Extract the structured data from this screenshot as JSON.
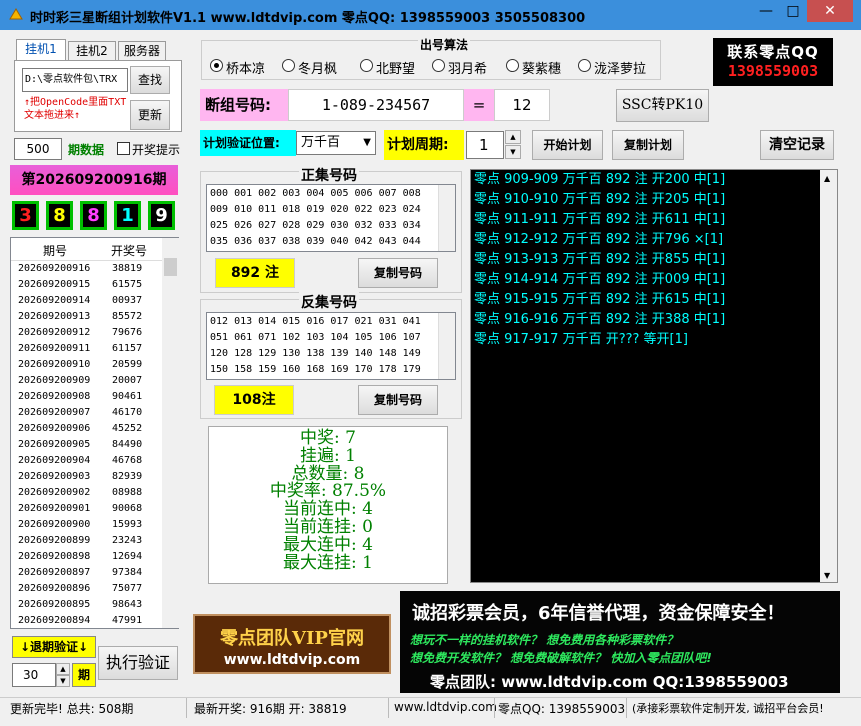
{
  "window": {
    "title": "时时彩三星断组计划软件V1.1   www.ldtdvip.com   零点QQ: 1398559003  3505508300",
    "min_label": "—",
    "max_label": "□",
    "close_label": "✕"
  },
  "tabs": [
    "挂机1",
    "挂机2",
    "服务器"
  ],
  "left": {
    "path_value": "D:\\零点软件包\\TRX",
    "search_btn": "查找",
    "update_btn": "更新",
    "hint": "↑把OpenCode里面TXT文本拖进来↑",
    "period_count": "500",
    "period_label": "期数据",
    "lottery_label": "开奖提示",
    "issue_title": "第202609200916期",
    "balls": [
      {
        "n": "3",
        "color": "#ff2020"
      },
      {
        "n": "8",
        "color": "#ffff00"
      },
      {
        "n": "8",
        "color": "#ff40ff"
      },
      {
        "n": "1",
        "color": "#00ffff"
      },
      {
        "n": "9",
        "color": "#ffffff"
      }
    ],
    "history_headers": [
      "期号",
      "开奖号"
    ],
    "history": [
      [
        "202609200916",
        "38819"
      ],
      [
        "202609200915",
        "61575"
      ],
      [
        "202609200914",
        "00937"
      ],
      [
        "202609200913",
        "85572"
      ],
      [
        "202609200912",
        "79676"
      ],
      [
        "202609200911",
        "61157"
      ],
      [
        "202609200910",
        "20599"
      ],
      [
        "202609200909",
        "20007"
      ],
      [
        "202609200908",
        "90461"
      ],
      [
        "202609200907",
        "46170"
      ],
      [
        "202609200906",
        "45252"
      ],
      [
        "202609200905",
        "84490"
      ],
      [
        "202609200904",
        "46768"
      ],
      [
        "202609200903",
        "82939"
      ],
      [
        "202609200902",
        "08988"
      ],
      [
        "202609200901",
        "90068"
      ],
      [
        "202609200900",
        "15993"
      ],
      [
        "202609200899",
        "23243"
      ],
      [
        "202609200898",
        "12694"
      ],
      [
        "202609200897",
        "97384"
      ],
      [
        "202609200896",
        "75077"
      ],
      [
        "202609200895",
        "98643"
      ],
      [
        "202609200894",
        "47991"
      ]
    ],
    "delay_btn": "↓退期验证↓",
    "delay_value": "30",
    "delay_unit": "期",
    "exec_btn": "执行验证"
  },
  "algo": {
    "title": "出号算法",
    "options": [
      "桥本凉",
      "冬月枫",
      "北野望",
      "羽月希",
      "葵紫穗",
      "泷泽萝拉"
    ],
    "selected": 0
  },
  "dz": {
    "label": "断组号码:",
    "code": "1-089-234567",
    "eq": "=",
    "num": "12",
    "ssc_btn": "SSC转PK10"
  },
  "plan": {
    "pos_label": "计划验证位置:",
    "pos_value": "万千百",
    "cycle_label": "计划周期:",
    "cycle_value": "1",
    "start_btn": "开始计划",
    "copy_btn": "复制计划",
    "clear_btn": "清空记录"
  },
  "forward": {
    "title": "正集号码",
    "codes": "000 001 002 003 004 005 006 007 008\n009 010 011 018 019 020 022 023 024\n025 026 027 028 029 030 032 033 034\n035 036 037 038 039 040 042 043 044",
    "count": "892 注",
    "copy": "复制号码"
  },
  "reverse": {
    "title": "反集号码",
    "codes": "012 013 014 015 016 017 021 031 041\n051 061 071 102 103 104 105 106 107\n120 128 129 130 138 139 140 148 149\n150 158 159 160 168 169 170 178 179",
    "count": "108注",
    "copy": "复制号码"
  },
  "stats": [
    "中奖: 7",
    "挂遍: 1",
    "总数量: 8",
    "中奖率: 87.5%",
    "当前连中: 4",
    "当前连挂: 0",
    "最大连中: 4",
    "最大连挂: 1"
  ],
  "vip": {
    "line1": "零点团队VIP官网",
    "line2": "www.ldtdvip.com"
  },
  "qq": {
    "line1": "联系零点QQ",
    "line2": "1398559003"
  },
  "log": [
    "零点 909-909 万千百 892 注 开200 中[1]",
    "零点 910-910 万千百 892 注 开205 中[1]",
    "零点 911-911 万千百 892 注 开611 中[1]",
    "零点 912-912 万千百 892 注 开796 ×[1]",
    "零点 913-913 万千百 892 注 开855 中[1]",
    "零点 914-914 万千百 892 注 开009 中[1]",
    "零点 915-915 万千百 892 注 开615 中[1]",
    "零点 916-916 万千百 892 注 开388 中[1]",
    "零点 917-917 万千百 开???  等开[1]"
  ],
  "ad": {
    "line1": "诚招彩票会员，6年信誉代理，资金保障安全！",
    "line2": "想玩不一样的挂机软件？ 想免费用各种彩票软件？",
    "line3": "想免费开发软件？ 想免费破解软件？ 快加入零点团队吧!",
    "line4": "零点团队: www.ldtdvip.com  QQ:1398559003"
  },
  "status": {
    "s1": "更新完毕! 总共: 508期",
    "s2": "最新开奖: 916期 开: 38819",
    "s3": "www.ldtdvip.com",
    "s4": "零点QQ: 1398559003",
    "s5": "(承接彩票软件定制开发, 诚招平台会员!"
  }
}
